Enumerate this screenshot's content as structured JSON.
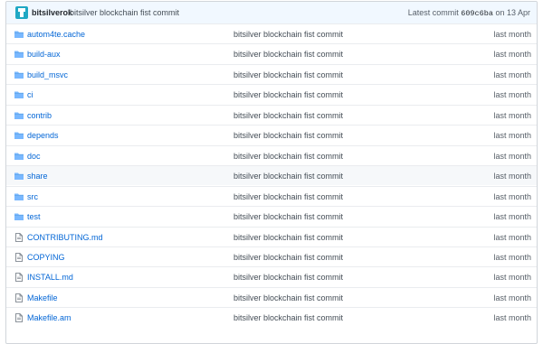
{
  "commit": {
    "author": "bitsilverok",
    "message": "bitsilver blockchain fist commit",
    "latest_label": "Latest commit",
    "sha": "609c6ba",
    "date_text": "on 13 Apr"
  },
  "files": [
    {
      "name": "autom4te.cache",
      "type": "folder",
      "message": "bitsilver blockchain fist commit",
      "age": "last month"
    },
    {
      "name": "build-aux",
      "type": "folder",
      "message": "bitsilver blockchain fist commit",
      "age": "last month"
    },
    {
      "name": "build_msvc",
      "type": "folder",
      "message": "bitsilver blockchain fist commit",
      "age": "last month"
    },
    {
      "name": "ci",
      "type": "folder",
      "message": "bitsilver blockchain fist commit",
      "age": "last month"
    },
    {
      "name": "contrib",
      "type": "folder",
      "message": "bitsilver blockchain fist commit",
      "age": "last month"
    },
    {
      "name": "depends",
      "type": "folder",
      "message": "bitsilver blockchain fist commit",
      "age": "last month"
    },
    {
      "name": "doc",
      "type": "folder",
      "message": "bitsilver blockchain fist commit",
      "age": "last month"
    },
    {
      "name": "share",
      "type": "folder",
      "message": "bitsilver blockchain fist commit",
      "age": "last month"
    },
    {
      "name": "src",
      "type": "folder",
      "message": "bitsilver blockchain fist commit",
      "age": "last month"
    },
    {
      "name": "test",
      "type": "folder",
      "message": "bitsilver blockchain fist commit",
      "age": "last month"
    },
    {
      "name": "CONTRIBUTING.md",
      "type": "file",
      "message": "bitsilver blockchain fist commit",
      "age": "last month"
    },
    {
      "name": "COPYING",
      "type": "file",
      "message": "bitsilver blockchain fist commit",
      "age": "last month"
    },
    {
      "name": "INSTALL.md",
      "type": "file",
      "message": "bitsilver blockchain fist commit",
      "age": "last month"
    },
    {
      "name": "Makefile",
      "type": "file",
      "message": "bitsilver blockchain fist commit",
      "age": "last month"
    },
    {
      "name": "Makefile.am",
      "type": "file",
      "message": "bitsilver blockchain fist commit",
      "age": "last month"
    }
  ],
  "colors": {
    "link": "#0366d6",
    "folder_icon": "#79b8ff",
    "file_icon": "#6a737d",
    "header_bg": "#f1f8ff"
  }
}
